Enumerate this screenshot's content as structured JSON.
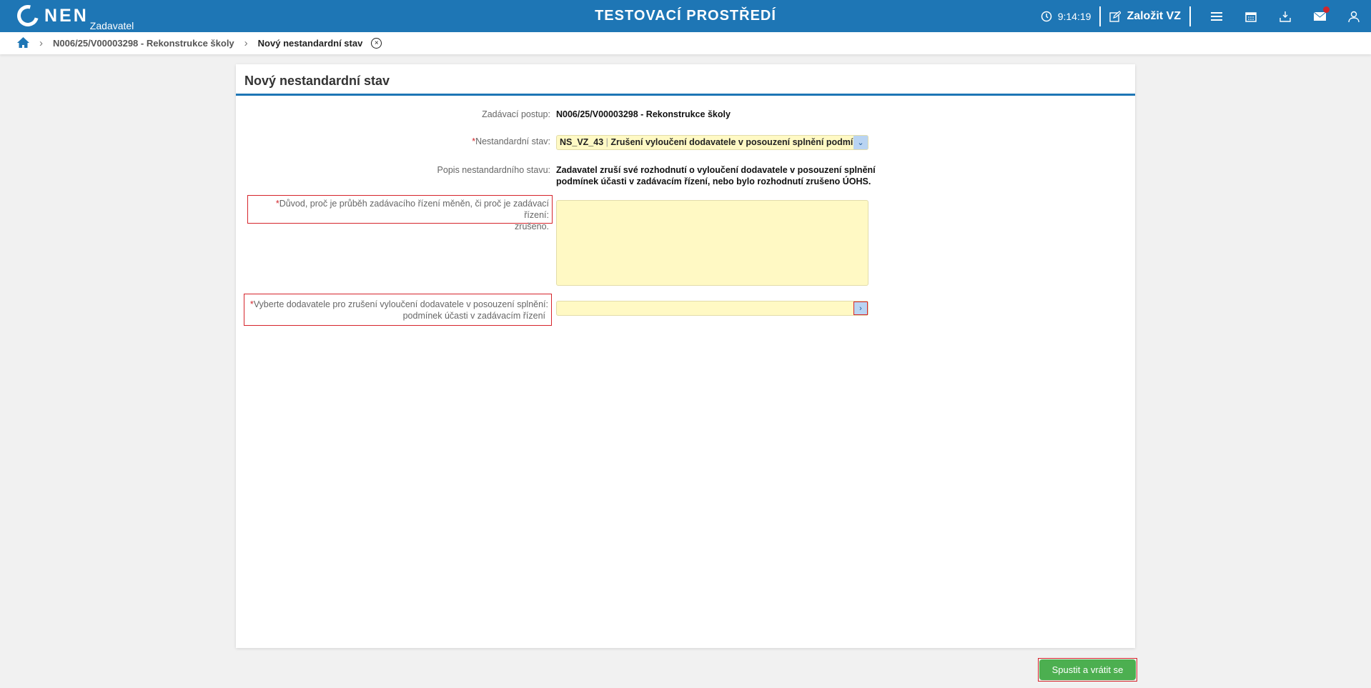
{
  "header": {
    "logo": "NEN",
    "logo_sub": "Zadavatel",
    "environment": "TESTOVACÍ PROSTŘEDÍ",
    "time": "9:14:19",
    "create_label": "Založit VZ",
    "accent": "#1e76b5"
  },
  "breadcrumb": {
    "items": [
      "N006/25/V00003298 - Rekonstrukce školy",
      "Nový nestandardní stav"
    ]
  },
  "form": {
    "title": "Nový nestandardní stav",
    "procedure_label": "Zadávací postup:",
    "procedure_value": "N006/25/V00003298 - Rekonstrukce školy",
    "state_label": "Nestandardní stav:",
    "state_code": "NS_VZ_43",
    "state_value": "Zrušení vyloučení dodavatele v posouzení splnění podmíne",
    "desc_label": "Popis nestandardního stavu:",
    "desc_line1": "Zadavatel zruší své rozhodnutí o vyloučení dodavatele v posouzení splnění",
    "desc_line2": "podmínek účasti v zadávacím řízení, nebo  bylo rozhodnutí  zrušeno ÚOHS.",
    "reason_label_1": "Důvod, proč je průběh zadávacího řízení měněn, či proč je zadávací řízení:",
    "reason_label_2": "zrušeno.",
    "reason_value": "",
    "supplier_label_1": "Vyberte dodavatele pro zrušení vyloučení dodavatele v posouzení splnění:",
    "supplier_label_2": "podmínek účasti v zadávacím řízení",
    "supplier_value": "",
    "required_mark": "*"
  },
  "actions": {
    "submit": "Spustit a vrátit se",
    "submit_color": "#4caf50"
  }
}
